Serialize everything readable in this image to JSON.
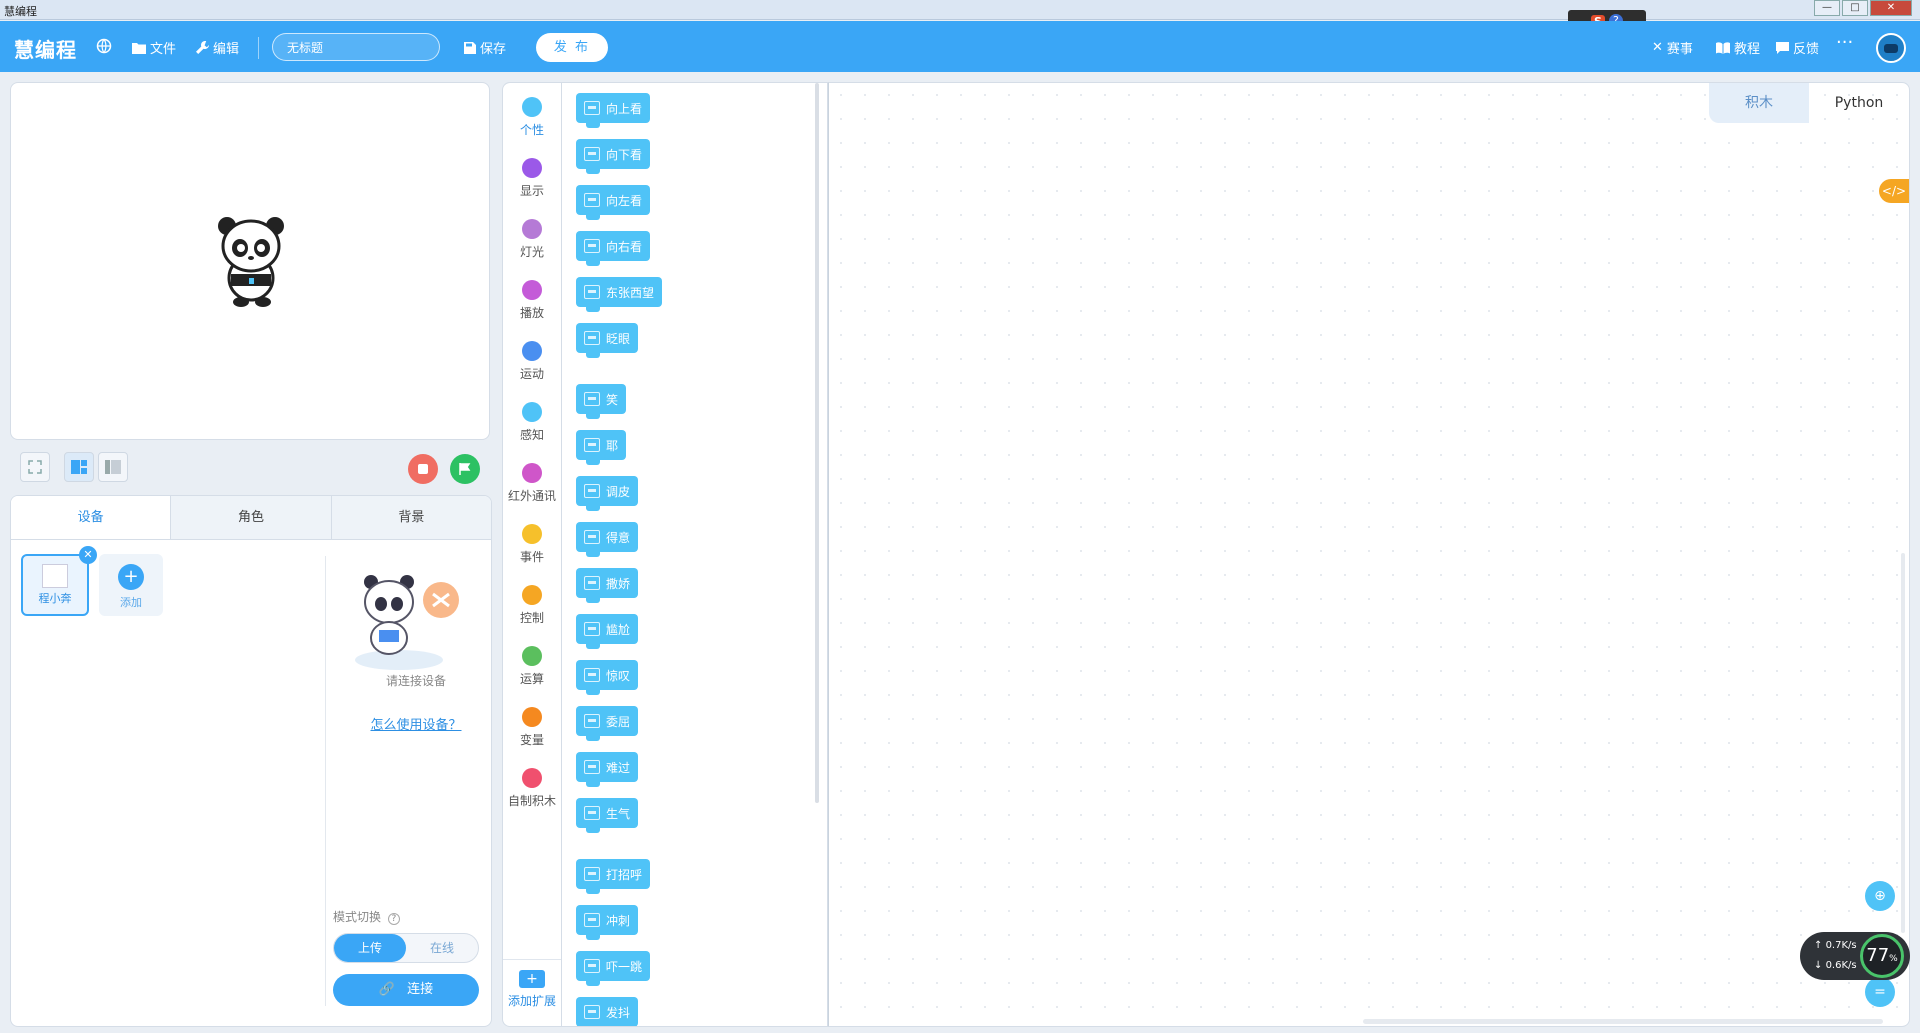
{
  "window": {
    "title": "慧编程",
    "controls": [
      "—",
      "□",
      "✕"
    ]
  },
  "ime": {
    "s_label": "S",
    "help_label": "?"
  },
  "topbar": {
    "brand": "慧编程",
    "file_label": "文件",
    "edit_label": "编辑",
    "project_title": "无标题",
    "save_label": "保存",
    "publish_label": "发 布",
    "contest_label": "赛事",
    "tutorial_label": "教程",
    "feedback_label": "反馈",
    "more_label": "···"
  },
  "lower_panel": {
    "tabs": [
      "设备",
      "角色",
      "背景"
    ],
    "device_name": "程小奔",
    "add_label": "添加",
    "connect_prompt": "请连接设备",
    "help_link": "怎么使用设备？",
    "mode_label": "模式切换",
    "mode_upload": "上传",
    "mode_online": "在线",
    "connect_label": "连接"
  },
  "categories": [
    {
      "label": "个性",
      "color": "#4fc3f7"
    },
    {
      "label": "显示",
      "color": "#9b59e8"
    },
    {
      "label": "灯光",
      "color": "#b57ad6"
    },
    {
      "label": "播放",
      "color": "#c45bd8"
    },
    {
      "label": "运动",
      "color": "#4a8ff0"
    },
    {
      "label": "感知",
      "color": "#4fc3f7"
    },
    {
      "label": "红外通讯",
      "color": "#cf56c9"
    },
    {
      "label": "事件",
      "color": "#f6c02b"
    },
    {
      "label": "控制",
      "color": "#f5a623"
    },
    {
      "label": "运算",
      "color": "#5bbf5e"
    },
    {
      "label": "变量",
      "color": "#f5891f"
    },
    {
      "label": "自制积木",
      "color": "#f0506e"
    }
  ],
  "add_extension_label": "添加扩展",
  "blocks": [
    "向上看",
    "向下看",
    "向左看",
    "向右看",
    "东张西望",
    "眨眼",
    "笑",
    "耶",
    "调皮",
    "得意",
    "撒娇",
    "尴尬",
    "惊叹",
    "委屈",
    "难过",
    "生气",
    "打招呼",
    "冲刺",
    "吓一跳",
    "发抖"
  ],
  "workspace": {
    "tab_blocks": "积木",
    "tab_python": "Python",
    "code_toggle": "</>"
  },
  "net_widget": {
    "up": "0.7K/s",
    "down": "0.6K/s",
    "cpu": "77"
  }
}
